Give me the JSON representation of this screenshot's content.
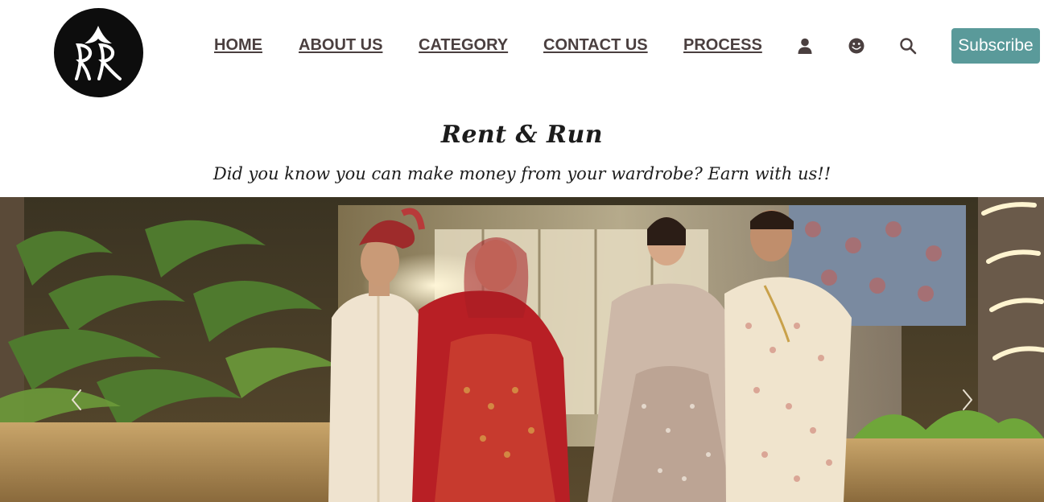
{
  "brand": {
    "logo_icon": "rr-monogram-logo"
  },
  "nav": {
    "items": [
      {
        "label": "HOME"
      },
      {
        "label": "ABOUT US"
      },
      {
        "label": "CATEGORY"
      },
      {
        "label": "CONTACT US"
      },
      {
        "label": "PROCESS"
      }
    ],
    "icons": [
      "user-icon",
      "smiley-icon",
      "search-icon"
    ],
    "subscribe_label": "Subscribe"
  },
  "hero": {
    "title": "Rent & Run",
    "subtitle": "Did you know you can make money from your wardrobe? Earn with us!!"
  },
  "carousel": {
    "prev_icon": "chevron-left-icon",
    "next_icon": "chevron-right-icon"
  },
  "colors": {
    "nav_text": "#4a3f3f",
    "subscribe_bg": "#5a9a9a",
    "logo_bg": "#0d0d0d"
  }
}
